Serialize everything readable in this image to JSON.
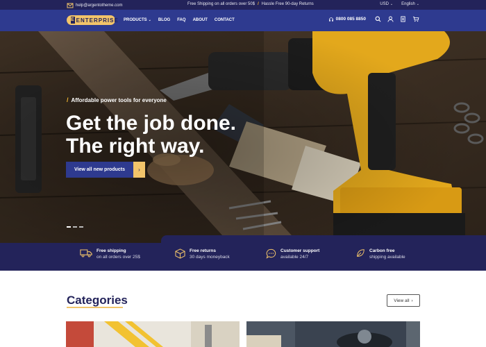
{
  "topbar": {
    "email": "help@argentotheme.com",
    "promo_1": "Free Shipping on all orders over 50$",
    "promo_2": "Hassle Free 90-day Returns",
    "currency": "USD",
    "language": "English"
  },
  "header": {
    "logo_text": "ENTERPRISE",
    "nav": [
      "PRODUCTS",
      "BLOG",
      "FAQ",
      "ABOUT",
      "CONTACT"
    ],
    "phone": "0800 085 8850",
    "icons": [
      "search-icon",
      "user-icon",
      "compare-icon",
      "cart-icon"
    ]
  },
  "hero": {
    "kicker": "Affordable power tools for everyone",
    "title_line1": "Get the job done.",
    "title_line2": "The right way.",
    "cta_label": "View all new products"
  },
  "features": [
    {
      "icon": "truck-icon",
      "title": "Free shipping",
      "subtitle": "on all orders over 25$"
    },
    {
      "icon": "box-icon",
      "title": "Free returns",
      "subtitle": "30 days moneyback"
    },
    {
      "icon": "chat-icon",
      "title": "Customer support",
      "subtitle": "available 24/7"
    },
    {
      "icon": "leaf-icon",
      "title": "Carbon free",
      "subtitle": "shipping available"
    }
  ],
  "categories": {
    "title": "Categories",
    "view_all": "View all"
  },
  "colors": {
    "navy": "#23235a",
    "nav_blue": "#2e3a8f",
    "accent_yellow": "#f2c46a"
  }
}
